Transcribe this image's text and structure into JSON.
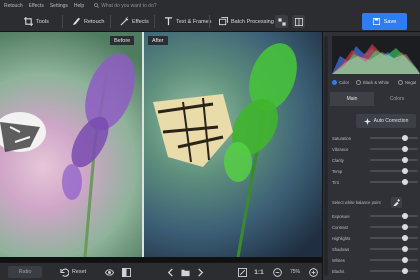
{
  "menu": {
    "items": [
      "Retouch",
      "Effects",
      "Settings",
      "Help"
    ],
    "search_placeholder": "What do you want to do?"
  },
  "toolbar": {
    "tools_label": "Tools",
    "retouch_label": "Retouch",
    "effects_label": "Effects",
    "text_frames_label": "Text & Frames",
    "batch_label": "Batch Processing",
    "save_label": "Save"
  },
  "canvas": {
    "before_label": "Before",
    "after_label": "After"
  },
  "bottom": {
    "ratio_value": "Ratio",
    "reset_label": "Reset",
    "fit_label": "1:1",
    "zoom_value": "75%"
  },
  "panel": {
    "color_modes": [
      "Color",
      "Black & White",
      "Negat"
    ],
    "selected_color_mode": "Color",
    "tabs": [
      "Main",
      "Colors"
    ],
    "active_tab": "Main",
    "auto_correction_label": "Auto Correction",
    "sliders_top": [
      {
        "label": "Saturation",
        "value": 0.72
      },
      {
        "label": "Vibrance",
        "value": 0.72
      },
      {
        "label": "Clarity",
        "value": 0.72
      },
      {
        "label": "Temp",
        "value": 0.72
      },
      {
        "label": "Tint",
        "value": 0.72
      }
    ],
    "white_balance_label": "Select white balance point",
    "sliders_bottom": [
      {
        "label": "Exposure",
        "value": 0.72
      },
      {
        "label": "Contrast",
        "value": 0.72
      },
      {
        "label": "Highlights",
        "value": 0.72
      },
      {
        "label": "Shadows",
        "value": 0.72
      },
      {
        "label": "Whites",
        "value": 0.72
      },
      {
        "label": "Blacks",
        "value": 0.72
      }
    ]
  },
  "colors": {
    "accent": "#2d7ef0",
    "toolbar_bg": "#2b2d31",
    "panel_bg": "#2f3136"
  }
}
